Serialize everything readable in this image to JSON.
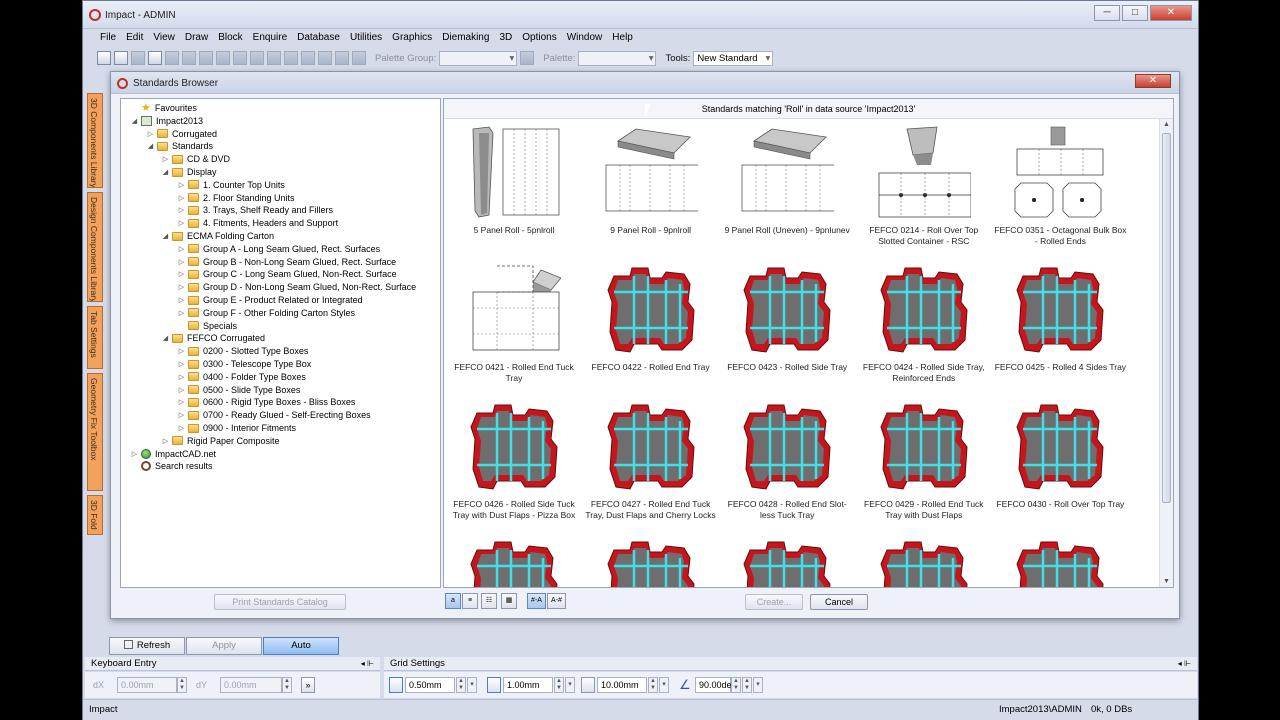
{
  "window": {
    "title": "Impact - ADMIN",
    "minimize": "─",
    "maximize": "□",
    "close": "✕"
  },
  "menu": [
    "File",
    "Edit",
    "View",
    "Draw",
    "Block",
    "Enquire",
    "Database",
    "Utilities",
    "Graphics",
    "Diemaking",
    "3D",
    "Options",
    "Window",
    "Help"
  ],
  "toolbar": {
    "palette_group_label": "Palette Group:",
    "palette_label": "Palette:",
    "tools_label": "Tools:",
    "tools_value": "New Standard"
  },
  "side_tabs": [
    "3D Components Library",
    "Design Components Library",
    "Tab Settings",
    "Geometry Fix Toolbox",
    "3D Fold"
  ],
  "dialog": {
    "title": "Standards Browser",
    "close": "✕",
    "results_header": "Standards matching 'Roll' in data source 'Impact2013'",
    "print_button": "Print Standards Catalog",
    "create_button": "Create...",
    "cancel_button": "Cancel",
    "view_buttons": [
      "a",
      "≡",
      "☷",
      "▦",
      "#-A",
      "A-#"
    ]
  },
  "tree": [
    {
      "label": "Favourites",
      "level": 0,
      "icon": "star",
      "toggle": ""
    },
    {
      "label": "Impact2013",
      "level": 0,
      "icon": "db",
      "toggle": "◢"
    },
    {
      "label": "Corrugated",
      "level": 1,
      "icon": "folder",
      "toggle": "▷"
    },
    {
      "label": "Standards",
      "level": 1,
      "icon": "folder",
      "toggle": "◢"
    },
    {
      "label": "CD & DVD",
      "level": 2,
      "icon": "folder",
      "toggle": "▷"
    },
    {
      "label": "Display",
      "level": 2,
      "icon": "folder",
      "toggle": "◢"
    },
    {
      "label": "1. Counter Top Units",
      "level": 3,
      "icon": "folder",
      "toggle": "▷"
    },
    {
      "label": "2. Floor Standing Units",
      "level": 3,
      "icon": "folder",
      "toggle": "▷"
    },
    {
      "label": "3. Trays, Shelf Ready and Fillers",
      "level": 3,
      "icon": "folder",
      "toggle": "▷"
    },
    {
      "label": "4. Fitments, Headers and Support",
      "level": 3,
      "icon": "folder",
      "toggle": "▷"
    },
    {
      "label": "ECMA Folding Carton",
      "level": 2,
      "icon": "folder",
      "toggle": "◢"
    },
    {
      "label": "Group A - Long Seam Glued, Rect. Surfaces",
      "level": 3,
      "icon": "folder",
      "toggle": "▷"
    },
    {
      "label": "Group B - Non-Long Seam Glued, Rect. Surface",
      "level": 3,
      "icon": "folder",
      "toggle": "▷"
    },
    {
      "label": "Group C - Long Seam Glued, Non-Rect. Surface",
      "level": 3,
      "icon": "folder",
      "toggle": "▷"
    },
    {
      "label": "Group D - Non-Long Seam Glued, Non-Rect. Surface",
      "level": 3,
      "icon": "folder",
      "toggle": "▷"
    },
    {
      "label": "Group E - Product Related or Integrated",
      "level": 3,
      "icon": "folder",
      "toggle": "▷"
    },
    {
      "label": "Group F - Other Folding Carton Styles",
      "level": 3,
      "icon": "folder",
      "toggle": "▷"
    },
    {
      "label": "Specials",
      "level": 3,
      "icon": "folder",
      "toggle": ""
    },
    {
      "label": "FEFCO Corrugated",
      "level": 2,
      "icon": "folder",
      "toggle": "◢"
    },
    {
      "label": "0200 - Slotted Type Boxes",
      "level": 3,
      "icon": "folder",
      "toggle": "▷"
    },
    {
      "label": "0300 - Telescope Type Box",
      "level": 3,
      "icon": "folder",
      "toggle": "▷"
    },
    {
      "label": "0400 - Folder Type Boxes",
      "level": 3,
      "icon": "folder",
      "toggle": "▷"
    },
    {
      "label": "0500 - Slide Type Boxes",
      "level": 3,
      "icon": "folder",
      "toggle": "▷"
    },
    {
      "label": "0600 - Rigid Type Boxes - Bliss Boxes",
      "level": 3,
      "icon": "folder",
      "toggle": "▷"
    },
    {
      "label": "0700 - Ready Glued - Self-Erecting Boxes",
      "level": 3,
      "icon": "folder",
      "toggle": "▷"
    },
    {
      "label": "0900 - Interior Fitments",
      "level": 3,
      "icon": "folder",
      "toggle": "▷"
    },
    {
      "label": "Rigid Paper Composite",
      "level": 2,
      "icon": "folder",
      "toggle": "▷"
    },
    {
      "label": "ImpactCAD.net",
      "level": 0,
      "icon": "globe",
      "toggle": "▷"
    },
    {
      "label": "Search results",
      "level": 0,
      "icon": "search",
      "toggle": ""
    }
  ],
  "results": [
    {
      "caption": "5 Panel Roll - 5pnlroll",
      "thumb": "tube"
    },
    {
      "caption": "9 Panel Roll - 9pnlroll",
      "thumb": "flat"
    },
    {
      "caption": "9 Panel Roll (Uneven) - 9pnlunev",
      "thumb": "flat"
    },
    {
      "caption": "FEFCO 0214 - Roll Over Top Slotted Container - RSC",
      "thumb": "rsc"
    },
    {
      "caption": "FEFCO 0351 - Octagonal Bulk Box - Rolled Ends",
      "thumb": "oct"
    },
    {
      "caption": "FEFCO 0421 - Rolled End Tuck Tray",
      "thumb": "tuck"
    },
    {
      "caption": "FEFCO 0422 - Rolled End Tray",
      "thumb": "red"
    },
    {
      "caption": "FEFCO 0423 - Rolled Side Tray",
      "thumb": "red"
    },
    {
      "caption": "FEFCO 0424 - Rolled Side Tray, Reinforced Ends",
      "thumb": "red"
    },
    {
      "caption": "FEFCO 0425 - Rolled 4 Sides Tray",
      "thumb": "red"
    },
    {
      "caption": "FEFCO 0426 - Rolled Side Tuck Tray with Dust Flaps - Pizza Box",
      "thumb": "red"
    },
    {
      "caption": "FEFCO 0427 - Rolled End Tuck Tray, Dust Flaps and Cherry Locks",
      "thumb": "red"
    },
    {
      "caption": "FEFCO 0428 - Rolled End Slot-less Tuck Tray",
      "thumb": "red"
    },
    {
      "caption": "FEFCO 0429 - Rolled End Tuck Tray with Dust Flaps",
      "thumb": "red"
    },
    {
      "caption": "FEFCO 0430 - Roll Over Top Tray",
      "thumb": "red"
    },
    {
      "caption": "",
      "thumb": "red"
    },
    {
      "caption": "",
      "thumb": "red"
    },
    {
      "caption": "",
      "thumb": "red"
    },
    {
      "caption": "",
      "thumb": "red"
    },
    {
      "caption": "",
      "thumb": "red"
    }
  ],
  "bottom": {
    "refresh": "Refresh",
    "apply": "Apply",
    "auto": "Auto"
  },
  "keyboard_entry": {
    "title": "Keyboard Entry",
    "dx_label": "dX",
    "dx_value": "0.00mm",
    "dy_label": "dY",
    "dy_value": "0.00mm",
    "go": "»"
  },
  "grid_settings": {
    "title": "Grid Settings",
    "v1": "0.50mm",
    "v2": "1.00mm",
    "v3": "10.00mm",
    "angle": "90.00de"
  },
  "status": {
    "left": "Impact",
    "user": "Impact2013\\ADMIN",
    "info": "0k, 0 DBs"
  },
  "colors": {
    "accent": "#3c8ce0",
    "thumb_red": "#c4161c",
    "thumb_cyan": "#3fe0e8",
    "thumb_grey": "#6e6e6e",
    "side_tab": "#f2a25a"
  }
}
